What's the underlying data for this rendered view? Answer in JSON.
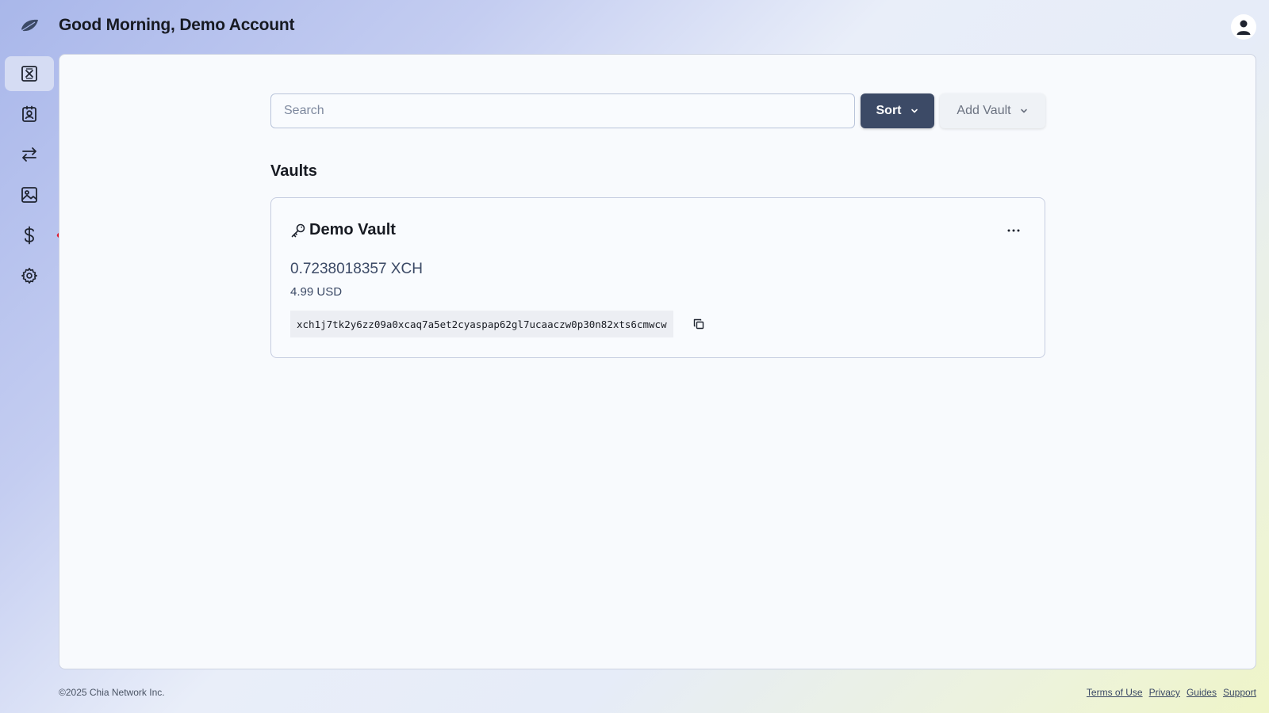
{
  "header": {
    "logo_icon": "chia-leaf-icon",
    "greeting": "Good Morning, Demo Account",
    "avatar_icon": "user-icon"
  },
  "sidebar": {
    "items": [
      {
        "icon": "wallet-x-icon",
        "active": true
      },
      {
        "icon": "contacts-icon",
        "active": false
      },
      {
        "icon": "transfer-arrows-icon",
        "active": false
      },
      {
        "icon": "image-gallery-icon",
        "active": false
      },
      {
        "icon": "dollar-icon",
        "active": false
      },
      {
        "icon": "settings-gear-icon",
        "active": false
      }
    ],
    "annotation_arrow_color": "#e0192e"
  },
  "toolbar": {
    "search_placeholder": "Search",
    "sort_label": "Sort",
    "add_vault_label": "Add Vault"
  },
  "vaults_section": {
    "title": "Vaults",
    "vaults": [
      {
        "name": "Demo Vault",
        "icon": "key-icon",
        "balance_xch": "0.7238018357 XCH",
        "balance_usd": "4.99 USD",
        "address": "xch1j7tk2y6zz09a0xcaq7a5et2cyaspap62gl7ucaaczw0p30n82xts6cmwcw"
      }
    ]
  },
  "footer": {
    "copyright": "©2025 Chia Network Inc.",
    "links": [
      "Terms of Use",
      "Privacy",
      "Guides",
      "Support"
    ]
  },
  "colors": {
    "primary_button": "#3c4a66",
    "accent_text": "#3c4a66"
  }
}
